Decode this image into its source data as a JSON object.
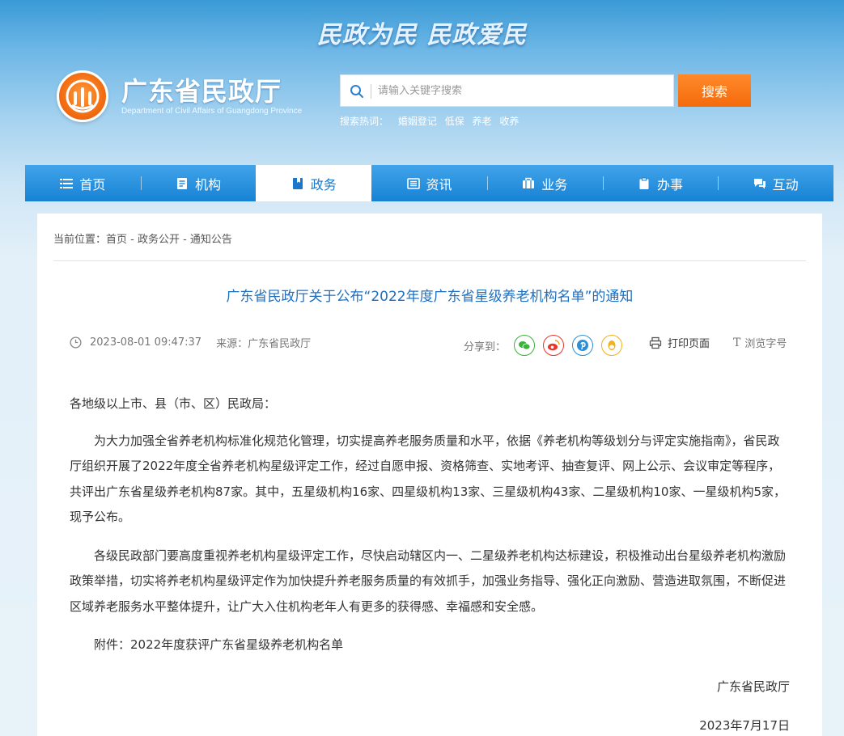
{
  "header": {
    "slogan": "民政为民 民政爱民",
    "site_name": "广东省民政厅",
    "site_name_en": "Department of Civil Affairs of Guangdong Province",
    "search_placeholder": "请输入关键字搜索",
    "search_button": "搜索",
    "hot_label": "搜索热词：",
    "hot_words": [
      "婚姻登记",
      "低保",
      "养老",
      "收养"
    ]
  },
  "nav": {
    "items": [
      {
        "label": "首页",
        "icon": "list-icon"
      },
      {
        "label": "机构",
        "icon": "document-icon"
      },
      {
        "label": "政务",
        "icon": "book-icon",
        "active": true
      },
      {
        "label": "资讯",
        "icon": "news-icon"
      },
      {
        "label": "业务",
        "icon": "briefcase-icon"
      },
      {
        "label": "办事",
        "icon": "clipboard-icon"
      },
      {
        "label": "互动",
        "icon": "chat-icon"
      }
    ]
  },
  "article": {
    "breadcrumb": "当前位置：首页 - 政务公开 - 通知公告",
    "title": "广东省民政厅关于公布“2022年度广东省星级养老机构名单”的通知",
    "datetime": "2023-08-01 09:47:37",
    "source": "来源：广东省民政厅",
    "share_label": "分享到：",
    "print_label": "打印页面",
    "font_label": "浏览字号",
    "salutation": "各地级以上市、县（市、区）民政局：",
    "paragraphs": [
      "为大力加强全省养老机构标准化规范化管理，切实提高养老服务质量和水平，依据《养老机构等级划分与评定实施指南》，省民政厅组织开展了2022年度全省养老机构星级评定工作，经过自愿申报、资格筛查、实地考评、抽查复评、网上公示、会议审定等程序，共评出广东省星级养老机构87家。其中，五星级机构16家、四星级机构13家、三星级机构43家、二星级机构10家、一星级机构5家，现予公布。",
      "各级民政部门要高度重视养老机构星级评定工作，尽快启动辖区内一、二星级养老机构达标建设，积极推动出台星级养老机构激励政策举措，切实将养老机构星级评定作为加快提升养老服务质量的有效抓手，加强业务指导、强化正向激励、营造进取氛围，不断促进区域养老服务水平整体提升，让广大入住机构老年人有更多的获得感、幸福感和安全感。",
      "附件：2022年度获评广东省星级养老机构名单"
    ],
    "signature": "广东省民政厅",
    "date": "2023年7月17日"
  },
  "colors": {
    "nav_blue": "#1782d4",
    "accent_orange": "#f46a0c",
    "title_blue": "#1f6fbf",
    "wechat": "#3bb33b",
    "weibo": "#e6362c",
    "pinterest": "#2b8fd8",
    "qq": "#f2b11b"
  }
}
